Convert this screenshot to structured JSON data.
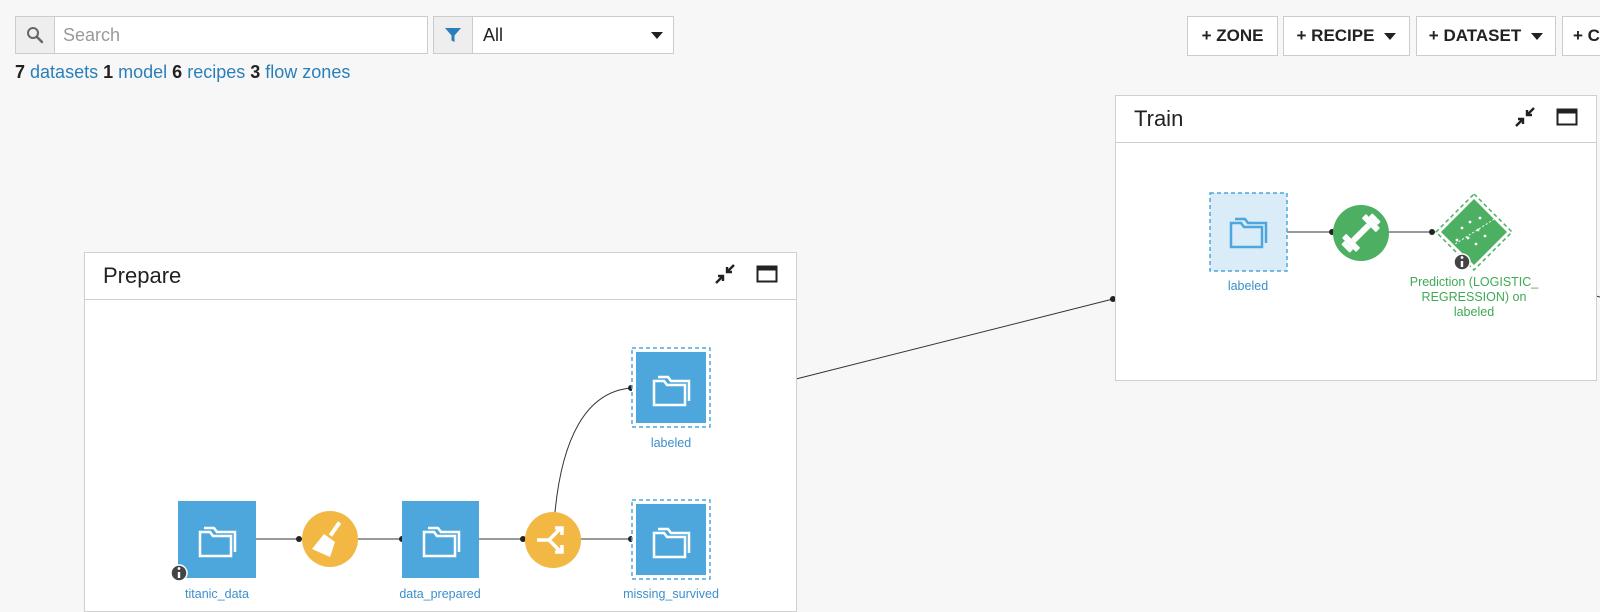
{
  "search": {
    "placeholder": "Search",
    "value": ""
  },
  "filter": {
    "selected": "All"
  },
  "counts": {
    "datasets_n": "7",
    "datasets_label": "datasets",
    "models_n": "1",
    "models_label": "model",
    "recipes_n": "6",
    "recipes_label": "recipes",
    "zones_n": "3",
    "zones_label": "flow zones"
  },
  "toolbar": {
    "zone_label": "+ ZONE",
    "recipe_label": "+ RECIPE",
    "dataset_label": "+ DATASET",
    "other_label": "+ C"
  },
  "zones": {
    "prepare": {
      "title": "Prepare",
      "nodes": {
        "titanic": "titanic_data",
        "prepared": "data_prepared",
        "labeled": "labeled",
        "missing": "missing_survived"
      }
    },
    "train": {
      "title": "Train",
      "nodes": {
        "labeled": "labeled",
        "prediction": "Prediction (LOGISTIC_ REGRESSION) on labeled"
      }
    }
  },
  "colors": {
    "dataset_blue": "#4ea7dc",
    "recipe_yellow": "#f2b843",
    "model_green": "#4caf62",
    "link_blue": "#2a7fba"
  }
}
